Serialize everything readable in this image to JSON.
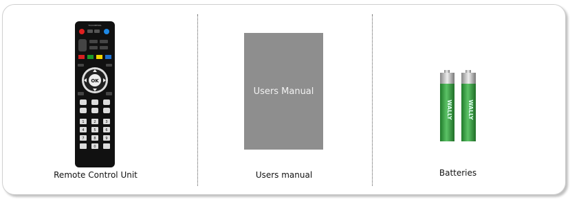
{
  "items": [
    {
      "caption": "Remote Control Unit"
    },
    {
      "caption": "Users manual",
      "book_title": "Users Manual"
    },
    {
      "caption": "Batteries",
      "battery_brand": "WALLY"
    }
  ],
  "remote": {
    "top_label": "TV/CONTROL",
    "ok_label": "OK",
    "keypad": [
      "1",
      "2",
      "3",
      "4",
      "5",
      "6",
      "7",
      "8",
      "9",
      "0"
    ]
  },
  "colors": {
    "remote_body": "#111111",
    "power_button": "#e02020",
    "blue_button": "#1e88e5",
    "color_keys": [
      "#d62020",
      "#1c9a2a",
      "#f2d600",
      "#1e6fd0"
    ],
    "manual_cover": "#8e8e8e",
    "battery_green": "#2e9e3a"
  }
}
